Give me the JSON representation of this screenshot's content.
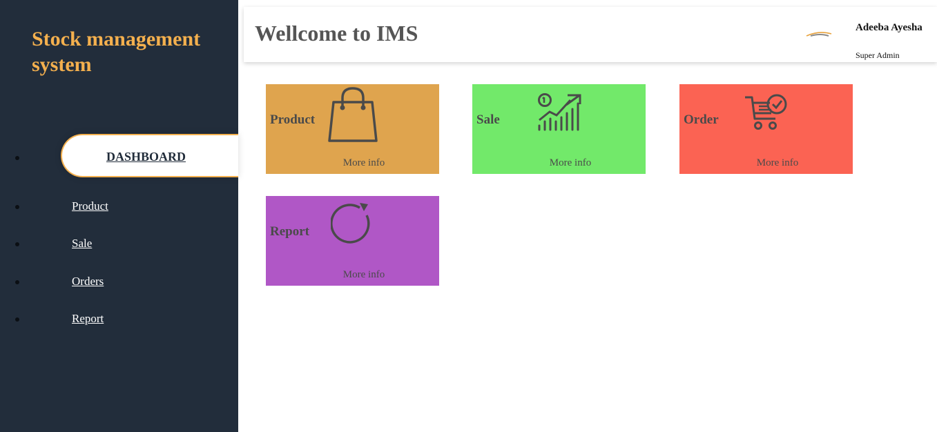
{
  "sidebar": {
    "brand": "Stock management system",
    "items": [
      {
        "label": "DASHBOARD",
        "active": true
      },
      {
        "label": "Product",
        "active": false
      },
      {
        "label": "Sale",
        "active": false
      },
      {
        "label": "Orders",
        "active": false
      },
      {
        "label": "Report",
        "active": false
      }
    ]
  },
  "header": {
    "title": "Wellcome to IMS",
    "user_name": "Adeeba Ayesha",
    "user_role": "Super Admin"
  },
  "cards": [
    {
      "label": "Product",
      "more": "More info",
      "icon": "shopping-bag-icon",
      "color": "#dfa44e"
    },
    {
      "label": "Sale",
      "more": "More info",
      "icon": "growth-chart-icon",
      "color": "#72e96a"
    },
    {
      "label": "Order",
      "more": "More info",
      "icon": "cart-check-icon",
      "color": "#fb6353"
    },
    {
      "label": "Report",
      "more": "More info",
      "icon": "refresh-icon",
      "color": "#b057c6"
    }
  ],
  "colors": {
    "sidebar_bg": "#222d3b",
    "brand": "#f4b04e",
    "icon_stroke": "#4a4a4a"
  }
}
